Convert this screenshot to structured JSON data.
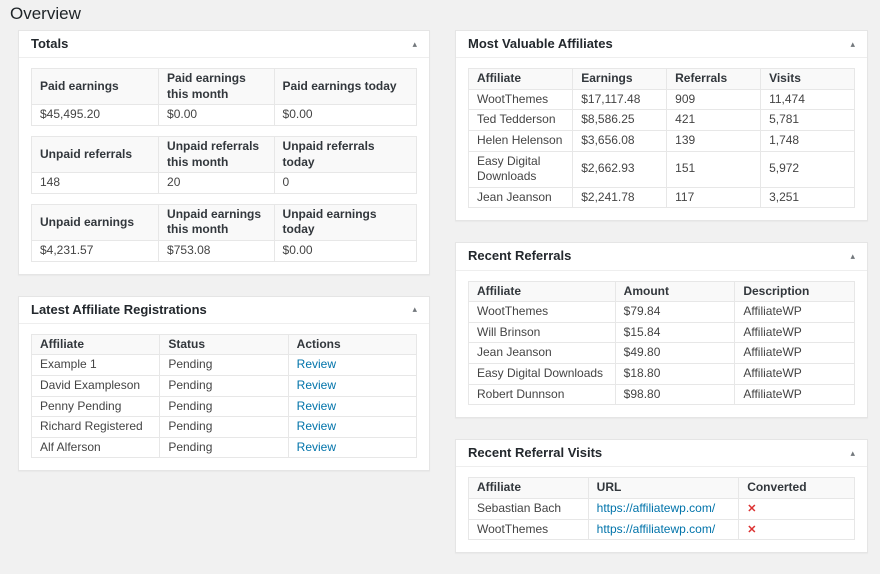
{
  "page": {
    "title": "Overview"
  },
  "icons": {
    "collapse_arrow": "▴",
    "x_mark": "✕"
  },
  "colors": {
    "link_blue": "#0073aa",
    "not_converted_red": "#dc3232",
    "page_background": "#f1f1f1",
    "panel_border": "#e5e5e5",
    "table_header_background": "#f9f9f9"
  },
  "panels": {
    "totals": {
      "title": "Totals",
      "tables": [
        {
          "columns": [
            {
              "label": "Paid earnings",
              "type": "text"
            },
            {
              "label": "Paid earnings this month",
              "type": "text"
            },
            {
              "label": "Paid earnings today",
              "type": "text"
            }
          ],
          "rows": [
            [
              "$45,495.20",
              "$0.00",
              "$0.00"
            ]
          ]
        },
        {
          "columns": [
            {
              "label": "Unpaid referrals",
              "type": "text"
            },
            {
              "label": "Unpaid referrals this month",
              "type": "text"
            },
            {
              "label": "Unpaid referrals today",
              "type": "text"
            }
          ],
          "rows": [
            [
              "148",
              "20",
              "0"
            ]
          ]
        },
        {
          "columns": [
            {
              "label": "Unpaid earnings",
              "type": "text"
            },
            {
              "label": "Unpaid earnings this month",
              "type": "text"
            },
            {
              "label": "Unpaid earnings today",
              "type": "text"
            }
          ],
          "rows": [
            [
              "$4,231.57",
              "$753.08",
              "$0.00"
            ]
          ]
        }
      ]
    },
    "latest_registrations": {
      "title": "Latest Affiliate Registrations",
      "columns": [
        {
          "label": "Affiliate",
          "type": "text"
        },
        {
          "label": "Status",
          "type": "text"
        },
        {
          "label": "Actions",
          "type": "link",
          "link_name": "review-link"
        }
      ],
      "rows": [
        [
          "Example 1",
          "Pending",
          "Review"
        ],
        [
          "David Exampleson",
          "Pending",
          "Review"
        ],
        [
          "Penny Pending",
          "Pending",
          "Review"
        ],
        [
          "Richard Registered",
          "Pending",
          "Review"
        ],
        [
          "Alf Alferson",
          "Pending",
          "Review"
        ]
      ]
    },
    "most_valuable": {
      "title": "Most Valuable Affiliates",
      "columns": [
        {
          "label": "Affiliate",
          "type": "text"
        },
        {
          "label": "Earnings",
          "type": "text"
        },
        {
          "label": "Referrals",
          "type": "text"
        },
        {
          "label": "Visits",
          "type": "text"
        }
      ],
      "rows": [
        [
          "WootThemes",
          "$17,117.48",
          "909",
          "11,474"
        ],
        [
          "Ted Tedderson",
          "$8,586.25",
          "421",
          "5,781"
        ],
        [
          "Helen Helenson",
          "$3,656.08",
          "139",
          "1,748"
        ],
        [
          "Easy Digital Downloads",
          "$2,662.93",
          "151",
          "5,972"
        ],
        [
          "Jean Jeanson",
          "$2,241.78",
          "117",
          "3,251"
        ]
      ]
    },
    "recent_referrals": {
      "title": "Recent Referrals",
      "columns": [
        {
          "label": "Affiliate",
          "type": "text"
        },
        {
          "label": "Amount",
          "type": "text"
        },
        {
          "label": "Description",
          "type": "text"
        }
      ],
      "rows": [
        [
          "WootThemes",
          "$79.84",
          "AffiliateWP"
        ],
        [
          "Will Brinson",
          "$15.84",
          "AffiliateWP"
        ],
        [
          "Jean Jeanson",
          "$49.80",
          "AffiliateWP"
        ],
        [
          "Easy Digital Downloads",
          "$18.80",
          "AffiliateWP"
        ],
        [
          "Robert Dunnson",
          "$98.80",
          "AffiliateWP"
        ]
      ]
    },
    "recent_visits": {
      "title": "Recent Referral Visits",
      "columns": [
        {
          "label": "Affiliate",
          "type": "text"
        },
        {
          "label": "URL",
          "type": "link",
          "link_name": "referral-url-link"
        },
        {
          "label": "Converted",
          "type": "x"
        }
      ],
      "rows": [
        [
          "Sebastian Bach",
          "https://affiliatewp.com/",
          "x"
        ],
        [
          "WootThemes",
          "https://affiliatewp.com/",
          "x"
        ]
      ]
    }
  }
}
